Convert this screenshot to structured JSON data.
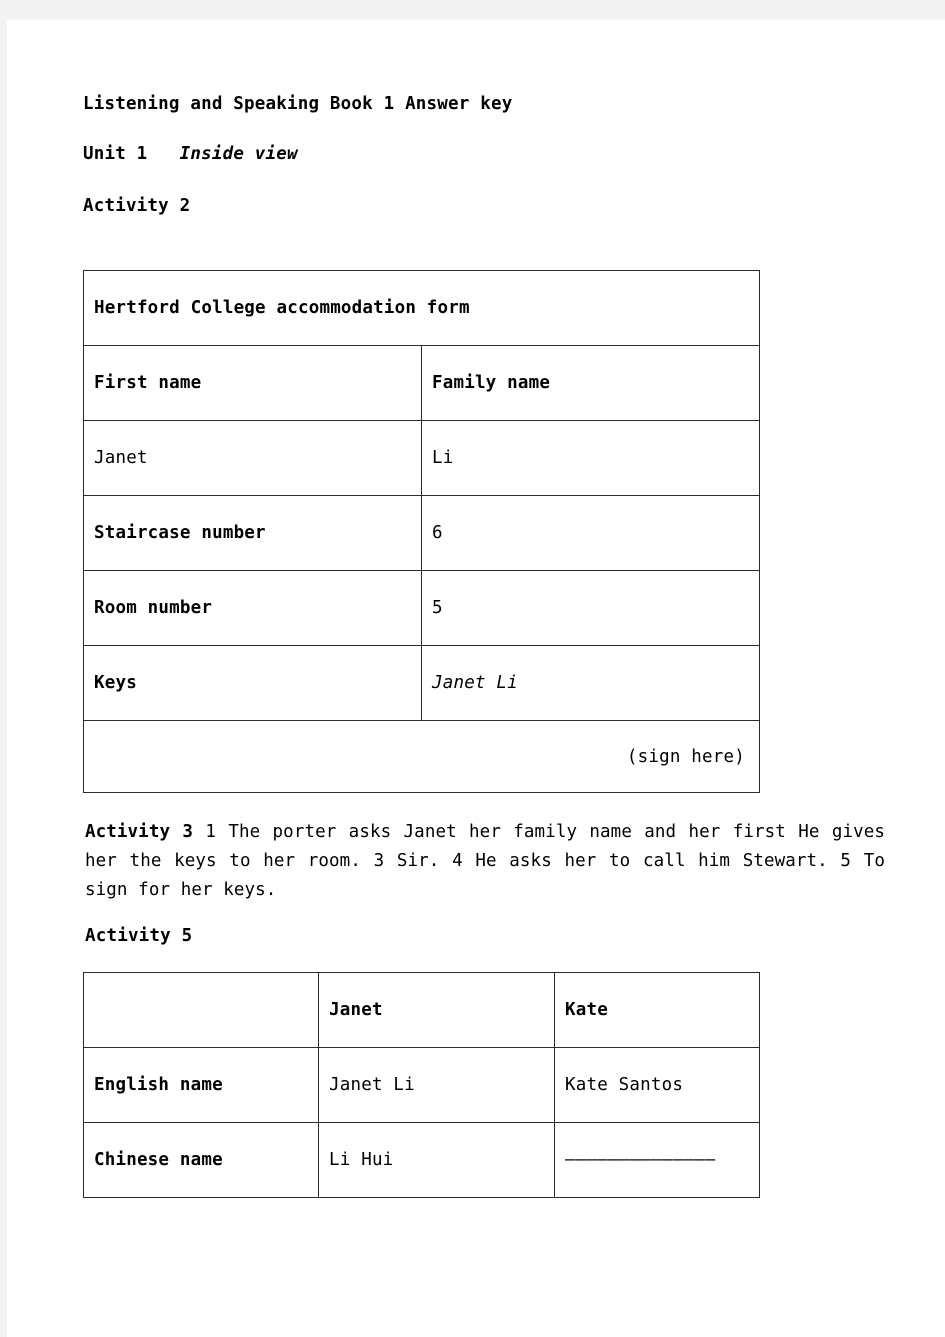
{
  "document": {
    "title": "Listening and Speaking Book 1 Answer key",
    "unit_label": "Unit 1",
    "unit_spacer": "   ",
    "unit_title": "Inside view",
    "activity2_label": "Activity 2",
    "activity5_label": "Activity 5"
  },
  "accommodation_form": {
    "caption": "Hertford College accommodation form",
    "rows": [
      {
        "label": "First name",
        "value": "Family name",
        "label_bold": true,
        "value_bold": true
      },
      {
        "label": "Janet",
        "value": "Li",
        "label_bold": false,
        "value_bold": false
      },
      {
        "label": "Staircase number",
        "value": "6",
        "label_bold": true,
        "value_bold": false
      },
      {
        "label": "Room number",
        "value": "5",
        "label_bold": true,
        "value_bold": false
      },
      {
        "label": "Keys",
        "value": "Janet Li",
        "label_bold": true,
        "value_bold": false,
        "value_italic": true
      }
    ],
    "sign_here": "(sign here)"
  },
  "activity3": {
    "label": "Activity 3",
    "text": "  1 The porter asks Janet her family name and her first  He gives her the keys to her room. 3 Sir. 4 He asks her to call him Stewart. 5 To sign for her keys."
  },
  "names_table": {
    "columns": [
      "",
      "Janet",
      "Kate"
    ],
    "rows": [
      {
        "label": "English name",
        "janet": "Janet Li",
        "kate": "Kate Santos"
      },
      {
        "label": "Chinese name",
        "janet": "Li Hui",
        "kate": "——————————————"
      }
    ]
  },
  "colors": {
    "page_background": "#f3f3f3",
    "paper": "#ffffff",
    "text": "#000000",
    "border": "#2b2b2b",
    "dash": "#808080"
  }
}
